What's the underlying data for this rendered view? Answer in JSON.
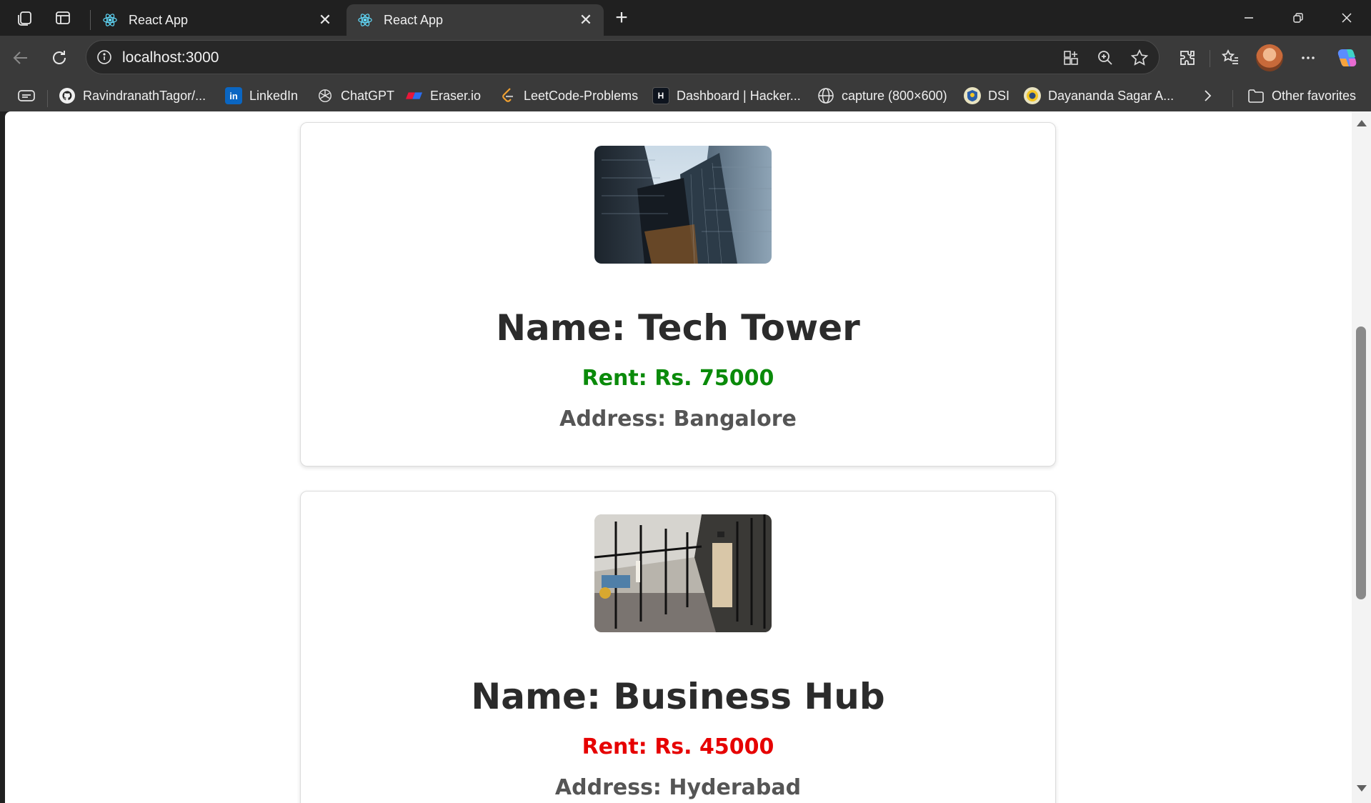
{
  "browser": {
    "tabs": [
      {
        "title": "React App",
        "active": false
      },
      {
        "title": "React App",
        "active": true
      }
    ],
    "url": "localhost:3000",
    "bookmarks": [
      {
        "label": "RavindranathTagor/...",
        "icon": "github-icon"
      },
      {
        "label": "LinkedIn",
        "icon": "linkedin-icon"
      },
      {
        "label": "ChatGPT",
        "icon": "chatgpt-icon"
      },
      {
        "label": "Eraser.io",
        "icon": "eraser-icon"
      },
      {
        "label": "LeetCode-Problems",
        "icon": "leetcode-icon"
      },
      {
        "label": "Dashboard | Hacker...",
        "icon": "hackerrank-icon"
      },
      {
        "label": "capture (800×600)",
        "icon": "globe-icon"
      },
      {
        "label": "DSI",
        "icon": "dsi-logo-icon"
      },
      {
        "label": "Dayananda Sagar A...",
        "icon": "dsu-logo-icon"
      }
    ],
    "other_favorites": "Other favorites"
  },
  "properties": [
    {
      "name": "Name: Tech Tower",
      "rent": "Rent: Rs. 75000",
      "rent_color": "#0a8a0a",
      "address": "Address: Bangalore",
      "image": "skyscrapers-photo"
    },
    {
      "name": "Name: Business Hub",
      "rent": "Rent: Rs. 45000",
      "rent_color": "#e60000",
      "address": "Address: Hyderabad",
      "image": "office-corridor-photo"
    }
  ]
}
